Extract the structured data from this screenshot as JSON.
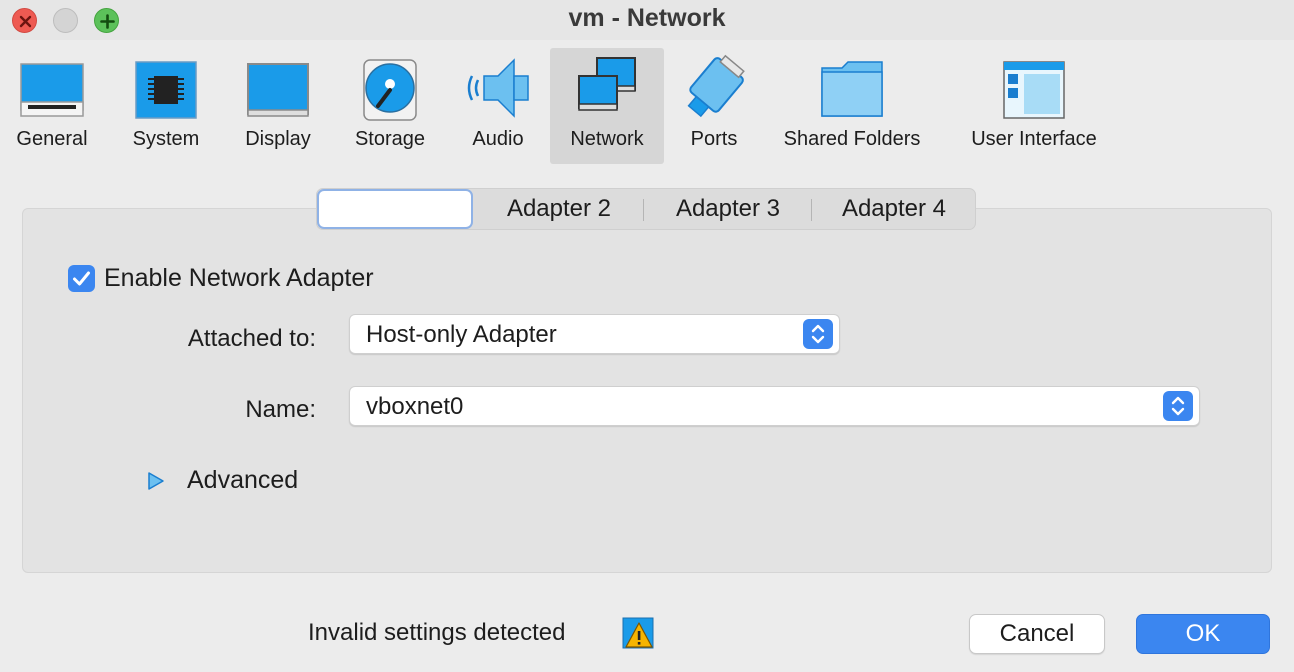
{
  "window": {
    "title": "vm - Network"
  },
  "toolbar": {
    "items": [
      {
        "label": "General",
        "icon": "general-icon"
      },
      {
        "label": "System",
        "icon": "system-icon"
      },
      {
        "label": "Display",
        "icon": "display-icon"
      },
      {
        "label": "Storage",
        "icon": "storage-icon"
      },
      {
        "label": "Audio",
        "icon": "audio-icon"
      },
      {
        "label": "Network",
        "icon": "network-icon",
        "selected": true
      },
      {
        "label": "Ports",
        "icon": "ports-icon"
      },
      {
        "label": "Shared Folders",
        "icon": "folder-icon"
      },
      {
        "label": "User Interface",
        "icon": "user-interface-icon"
      }
    ]
  },
  "tabs": {
    "items": [
      {
        "label": "",
        "active": true
      },
      {
        "label": "Adapter 2"
      },
      {
        "label": "Adapter 3"
      },
      {
        "label": "Adapter 4"
      }
    ]
  },
  "adapter": {
    "enable_label": "Enable Network Adapter",
    "enabled": true,
    "attached_label": "Attached to:",
    "attached_value": "Host-only Adapter",
    "name_label": "Name:",
    "name_value": "vboxnet0",
    "advanced_label": "Advanced"
  },
  "footer": {
    "status": "Invalid settings detected",
    "cancel_label": "Cancel",
    "ok_label": "OK"
  },
  "colors": {
    "accent": "#3b86f0",
    "icon_blue": "#1a9be9",
    "close": "#ee5a52",
    "maximize": "#5cc15a",
    "warning": "#f5b400"
  }
}
